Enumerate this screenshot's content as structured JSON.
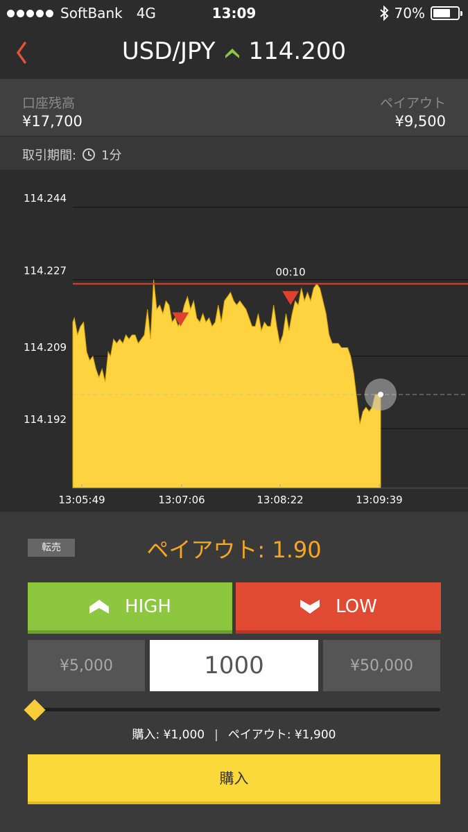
{
  "status": {
    "carrier": "SoftBank",
    "network": "4G",
    "time": "13:09",
    "battery": "70%",
    "battery_level": 0.7
  },
  "header": {
    "pair": "USD/JPY",
    "price": "114.200",
    "trend": "up"
  },
  "account": {
    "balance_label": "口座残高",
    "balance_value": "¥17,700",
    "payout_label": "ペイアウト",
    "payout_value": "¥9,500"
  },
  "period": {
    "label": "取引期間:",
    "value": "1分"
  },
  "chart_data": {
    "type": "area",
    "y_ticks": [
      "114.244",
      "114.227",
      "114.209",
      "114.192"
    ],
    "x_ticks": [
      "13:05:49",
      "13:07:06",
      "13:08:22",
      "13:09:39"
    ],
    "ylim": [
      114.178,
      114.251
    ],
    "x_range": [
      0,
      40
    ],
    "target_rate": 114.226,
    "current_rate": 114.2,
    "countdown_label": "00:10",
    "markers": [
      {
        "type": "low",
        "x": 14.0,
        "y": 114.218
      },
      {
        "type": "low",
        "x": 28.3,
        "y": 114.223
      }
    ],
    "x": [
      0,
      0.2,
      0.6,
      1.0,
      1.4,
      1.8,
      2.2,
      2.6,
      3.0,
      3.4,
      3.8,
      4.2,
      4.6,
      4.9,
      5.3,
      5.7,
      6.1,
      6.5,
      6.9,
      7.3,
      7.7,
      8.1,
      8.5,
      8.9,
      9.3,
      9.7,
      10.1,
      10.5,
      10.9,
      11.3,
      11.7,
      12.1,
      12.5,
      12.9,
      13.3,
      13.7,
      14.1,
      14.5,
      14.9,
      15.3,
      15.7,
      16.1,
      16.5,
      16.9,
      17.3,
      17.7,
      18.1,
      18.5,
      18.9,
      19.3,
      19.7,
      20.1,
      20.5,
      20.9,
      21.3,
      21.7,
      22.1,
      22.5,
      22.9,
      23.3,
      23.7,
      24.1,
      24.5,
      24.9,
      25.3,
      25.7,
      26.1,
      26.5,
      26.9,
      27.3,
      27.7,
      28.1,
      28.5,
      28.9,
      29.3,
      29.7,
      30.1,
      30.5,
      30.9,
      31.3,
      31.7,
      32.1,
      32.5,
      32.9,
      33.3,
      33.7,
      34.1,
      34.5,
      34.9,
      35.3,
      35.7,
      36.1,
      36.5,
      36.9,
      37.3,
      37.7,
      38.1,
      38.5,
      38.9,
      39.3,
      39.7,
      40.0
    ],
    "values": [
      114.217,
      114.218,
      114.214,
      114.216,
      114.217,
      114.21,
      114.208,
      114.209,
      114.206,
      114.204,
      114.206,
      114.203,
      114.21,
      114.209,
      114.213,
      114.212,
      114.213,
      114.212,
      114.214,
      114.213,
      114.214,
      114.214,
      114.212,
      114.213,
      114.214,
      114.22,
      114.213,
      114.227,
      114.22,
      114.221,
      114.219,
      114.222,
      114.221,
      114.217,
      114.218,
      114.216,
      114.218,
      114.221,
      114.223,
      114.22,
      114.222,
      114.218,
      114.217,
      114.219,
      114.217,
      114.218,
      114.216,
      114.217,
      114.221,
      114.217,
      114.222,
      114.223,
      114.224,
      114.222,
      114.221,
      114.222,
      114.221,
      114.22,
      114.218,
      114.216,
      114.216,
      114.219,
      114.215,
      114.217,
      114.216,
      114.216,
      114.221,
      114.216,
      114.212,
      114.214,
      114.219,
      114.215,
      114.219,
      114.222,
      114.221,
      114.225,
      114.222,
      114.224,
      114.222,
      114.225,
      114.226,
      114.225,
      114.222,
      114.219,
      114.214,
      114.212,
      114.212,
      114.212,
      114.211,
      114.211,
      114.211,
      114.209,
      114.205,
      114.199,
      114.193,
      114.196,
      114.197,
      114.196,
      114.197,
      114.2,
      114.2,
      114.2
    ]
  },
  "trade": {
    "resale_label": "転売",
    "payout_rate": "ペイアウト: 1.90",
    "high_label": "HIGH",
    "low_label": "LOW",
    "min_amount": "¥5,000",
    "amount_value": "1000",
    "max_amount": "¥50,000",
    "slider_position": 0,
    "purchase_summary": "購入: ¥1,000",
    "payout_summary": "ペイアウト: ¥1,900",
    "separator": "|",
    "buy_label": "購入"
  },
  "colors": {
    "area_fill": "#ffd23f",
    "target_line": "#e0412f",
    "high": "#8dc63f",
    "low": "#e04a33",
    "payout_accent": "#f5a623"
  },
  "icons": {
    "back": "chevron-left-icon",
    "trend": "up-arrow-icon",
    "clock": "clock-icon",
    "bluetooth": "bluetooth-icon",
    "battery": "battery-icon"
  }
}
